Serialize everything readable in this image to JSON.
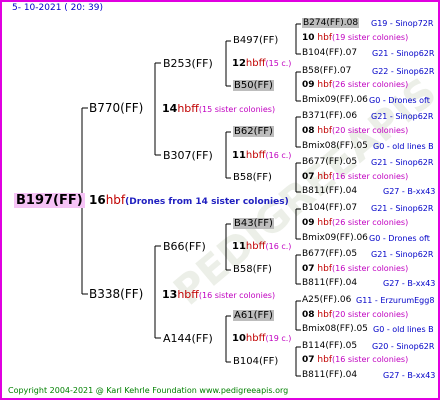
{
  "header": {
    "date": "5- 10-2021 ( 20: 39)"
  },
  "footer": {
    "copyright": "Copyright 2004-2021 @ Karl Kehrle Foundation   www.pedigreeapis.org"
  },
  "colors": {
    "border": "#e000e0",
    "root_bg": "#f6c3f6",
    "box_bg": "#bdbdbd",
    "hbf": "#c00000",
    "colonies": "#c000c0",
    "annotation": "#0000c8",
    "footer": "#008000"
  },
  "root": {
    "name": "B197(FF)",
    "num": "16",
    "hbf": "hbf",
    "colonies": "(Drones from 14 sister colonies)"
  },
  "gen1": [
    {
      "name": "B770(FF)",
      "num": "14",
      "hbf": "hbff",
      "colonies": "(15 sister colonies)"
    },
    {
      "name": "B338(FF)",
      "num": "13",
      "hbf": "hbff",
      "colonies": "(16 sister colonies)"
    }
  ],
  "gen2": [
    {
      "name": "B253(FF)",
      "num": "12",
      "hbf": "hbff",
      "colonies": "(15 c.)"
    },
    {
      "name": "B307(FF)",
      "num": "11",
      "hbf": "hbff",
      "colonies": "(16 c.)"
    },
    {
      "name": "B66(FF)",
      "num": "11",
      "hbf": "hbff",
      "colonies": "(16 c.)"
    },
    {
      "name": "A144(FF)",
      "num": "10",
      "hbf": "hbff",
      "colonies": "(19 c.)"
    }
  ],
  "gen3": [
    {
      "name": "B497(FF)"
    },
    {
      "name": "B50(FF)"
    },
    {
      "name": "B62(FF)"
    },
    {
      "name": "B58(FF)"
    },
    {
      "name": "B43(FF)"
    },
    {
      "name": "B58(FF)"
    },
    {
      "name": "A61(FF)"
    },
    {
      "name": "B104(FF)"
    }
  ],
  "gen4": [
    {
      "queen": "B274(FF).08",
      "num": "10",
      "hbf": "hbf",
      "colonies": "(19 sister colonies)",
      "drone": "B104(FF).07",
      "g1": "G19 - Sinop72R",
      "g2": "G21 - Sinop62R"
    },
    {
      "queen": "B58(FF).07",
      "num": "09",
      "hbf": "hbf",
      "colonies": "(26 sister colonies)",
      "drone": "Bmix09(FF).06",
      "g1": "G22 - Sinop62R",
      "g2": "G0 - Drones oft"
    },
    {
      "queen": "B371(FF).06",
      "num": "08",
      "hbf": "hbf",
      "colonies": "(20 sister colonies)",
      "drone": "Bmix08(FF).05",
      "g1": "G21 - Sinop62R",
      "g2": "G0 - old lines B"
    },
    {
      "queen": "B677(FF).05",
      "num": "07",
      "hbf": "hbf",
      "colonies": "(16 sister colonies)",
      "drone": "B811(FF).04",
      "g1": "G21 - Sinop62R",
      "g2": "G27 - B-xx43"
    },
    {
      "queen": "B104(FF).07",
      "num": "09",
      "hbf": "hbf",
      "colonies": "(26 sister colonies)",
      "drone": "Bmix09(FF).06",
      "g1": "G21 - Sinop62R",
      "g2": "G0 - Drones oft"
    },
    {
      "queen": "B677(FF).05",
      "num": "07",
      "hbf": "hbf",
      "colonies": "(16 sister colonies)",
      "drone": "B811(FF).04",
      "g1": "G21 - Sinop62R",
      "g2": "G27 - B-xx43"
    },
    {
      "queen": "A25(FF).06",
      "num": "08",
      "hbf": "hbf",
      "colonies": "(20 sister colonies)",
      "drone": "Bmix08(FF).05",
      "g1": "G11 - ErzurumEgg8",
      "g2": "G0 - old lines B"
    },
    {
      "queen": "B114(FF).05",
      "num": "07",
      "hbf": "hbf",
      "colonies": "(16 sister colonies)",
      "drone": "B811(FF).04",
      "g1": "G20 - Sinop62R",
      "g2": "G27 - B-xx43"
    }
  ],
  "watermark": "PEDIGREEAPIS"
}
